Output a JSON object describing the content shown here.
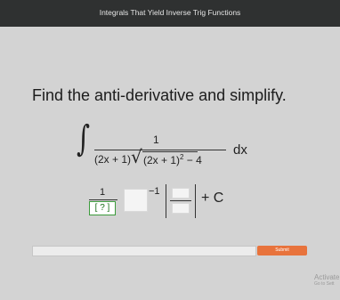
{
  "header": {
    "title": "Integrals That Yield Inverse Trig Functions"
  },
  "question": {
    "prompt": "Find the anti-derivative and simplify."
  },
  "integrand": {
    "integral_sign": "∫",
    "numerator": "1",
    "denominator_left": "(2x + 1)",
    "sqrt_symbol": "√",
    "sqrt_inner": "(2x + 1)",
    "sqrt_exp": "2",
    "sqrt_rest": " − 4",
    "differential": "dx"
  },
  "answer": {
    "numerator": "1",
    "denominator_placeholder": "[ ? ]",
    "exponent": "−1",
    "constant": "+ C"
  },
  "actions": {
    "submit_label": "Submit"
  },
  "watermark": {
    "line1": "Activate",
    "line2": "Go to Sett"
  },
  "colors": {
    "header_bg": "#2f3131",
    "accent": "#e8733c",
    "placeholder_border": "#3c9b3c"
  }
}
